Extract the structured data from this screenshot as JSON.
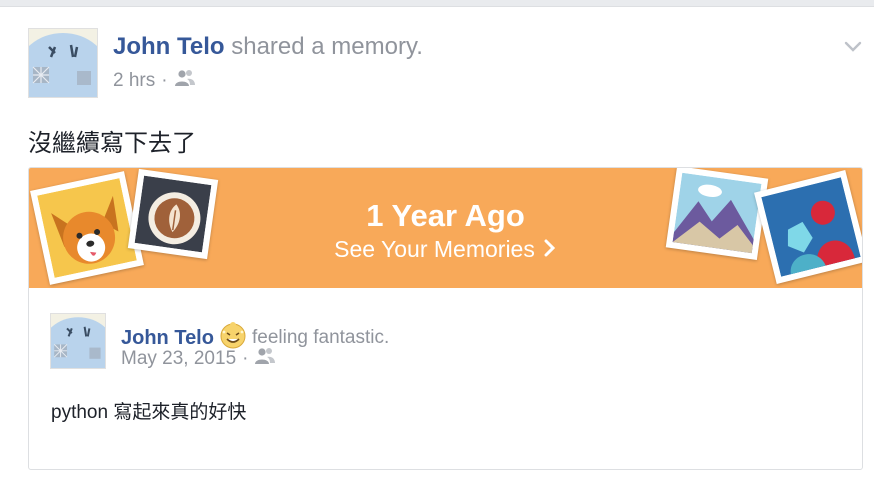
{
  "post": {
    "author": "John Telo",
    "action": " shared a memory.",
    "time": "2 hrs",
    "separator": "·",
    "audience_icon": "friends-icon",
    "menu_icon": "chevron-down-icon",
    "text": "沒繼續寫下去了"
  },
  "memory_card": {
    "title": "1 Year Ago",
    "subtitle": "See Your Memories",
    "arrow_icon": "chevron-right-icon",
    "banner_color": "#f8a959",
    "original_post": {
      "author": "John Telo",
      "feeling_icon": "feeling-fantastic-emoji-icon",
      "feeling": "feeling fantastic.",
      "date": "May 23, 2015",
      "separator": "·",
      "audience_icon": "friends-icon",
      "text": "python 寫起來真的好快"
    }
  },
  "colors": {
    "link": "#365899",
    "secondary_text": "#90949c",
    "body_text": "#1d2129"
  }
}
